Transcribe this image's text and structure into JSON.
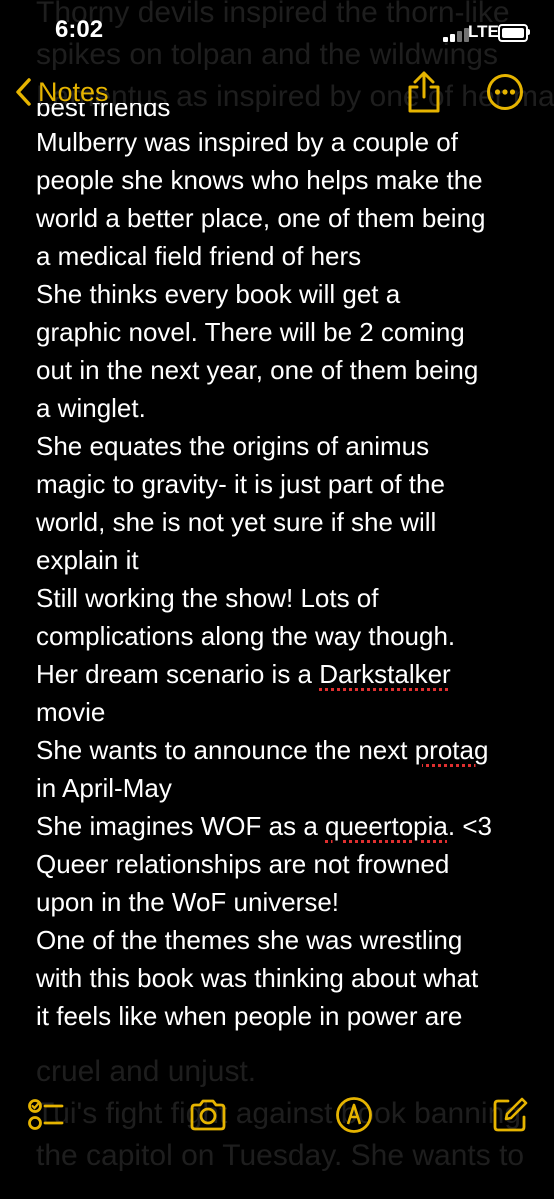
{
  "status_bar": {
    "time": "6:02",
    "network": "LTE",
    "battery_level": 1.0
  },
  "nav": {
    "back_label": "Notes",
    "share_icon": "share-icon",
    "more_icon": "ellipsis-circle-icon"
  },
  "colors": {
    "accent": "#e6b400",
    "background": "#000000",
    "text": "#ffffff",
    "spellcheck": "#e03030"
  },
  "note": {
    "scrolled_top_lines": [
      "Thorny devils inspired the thorn-like",
      "spikes on tolpan and the wildwings",
      "Lamentus as inspired by one of her mais"
    ],
    "visible_lines": [
      {
        "text": "best friends"
      },
      {
        "text": "Mulberry was inspired by a couple of"
      },
      {
        "text": "people she knows who helps make the"
      },
      {
        "text": "world a better place, one of them being"
      },
      {
        "text": "a medical field friend of hers"
      },
      {
        "text": "She thinks every book will get a"
      },
      {
        "text": "graphic novel. There will be 2 coming"
      },
      {
        "text": "out in the next year, one of them being"
      },
      {
        "text": "a winglet."
      },
      {
        "text": "She equates the origins of animus"
      },
      {
        "text": "magic to gravity- it is just part of the"
      },
      {
        "text": "world, she is not yet sure if she will"
      },
      {
        "text": "explain it"
      },
      {
        "text": "Still working the show! Lots of"
      },
      {
        "text": "complications along the way though."
      },
      {
        "before": "Her dream scenario is a ",
        "flagged": "Darkstalker",
        "after": ""
      },
      {
        "text": "movie"
      },
      {
        "before": "She wants to announce the next ",
        "flagged": "protag",
        "after": ""
      },
      {
        "text": "in April-May"
      },
      {
        "before": "She imagines WOF as a ",
        "flagged": "queertopia",
        "after": ". <3"
      },
      {
        "text": "Queer relationships are not frowned"
      },
      {
        "text": "upon in the WoF universe!"
      },
      {
        "text": "One of the themes she was wrestling"
      },
      {
        "text": "with this book was thinking about what"
      },
      {
        "text": "it feels like when people in power are"
      }
    ],
    "scrolled_bottom_lines": [
      "cruel and unjust.",
      "Tui's fight fight against book banning",
      "the capitol on Tuesday. She wants to"
    ]
  },
  "toolbar": {
    "icons": [
      "checklist-icon",
      "camera-icon",
      "markup-pen-icon",
      "compose-icon"
    ]
  }
}
